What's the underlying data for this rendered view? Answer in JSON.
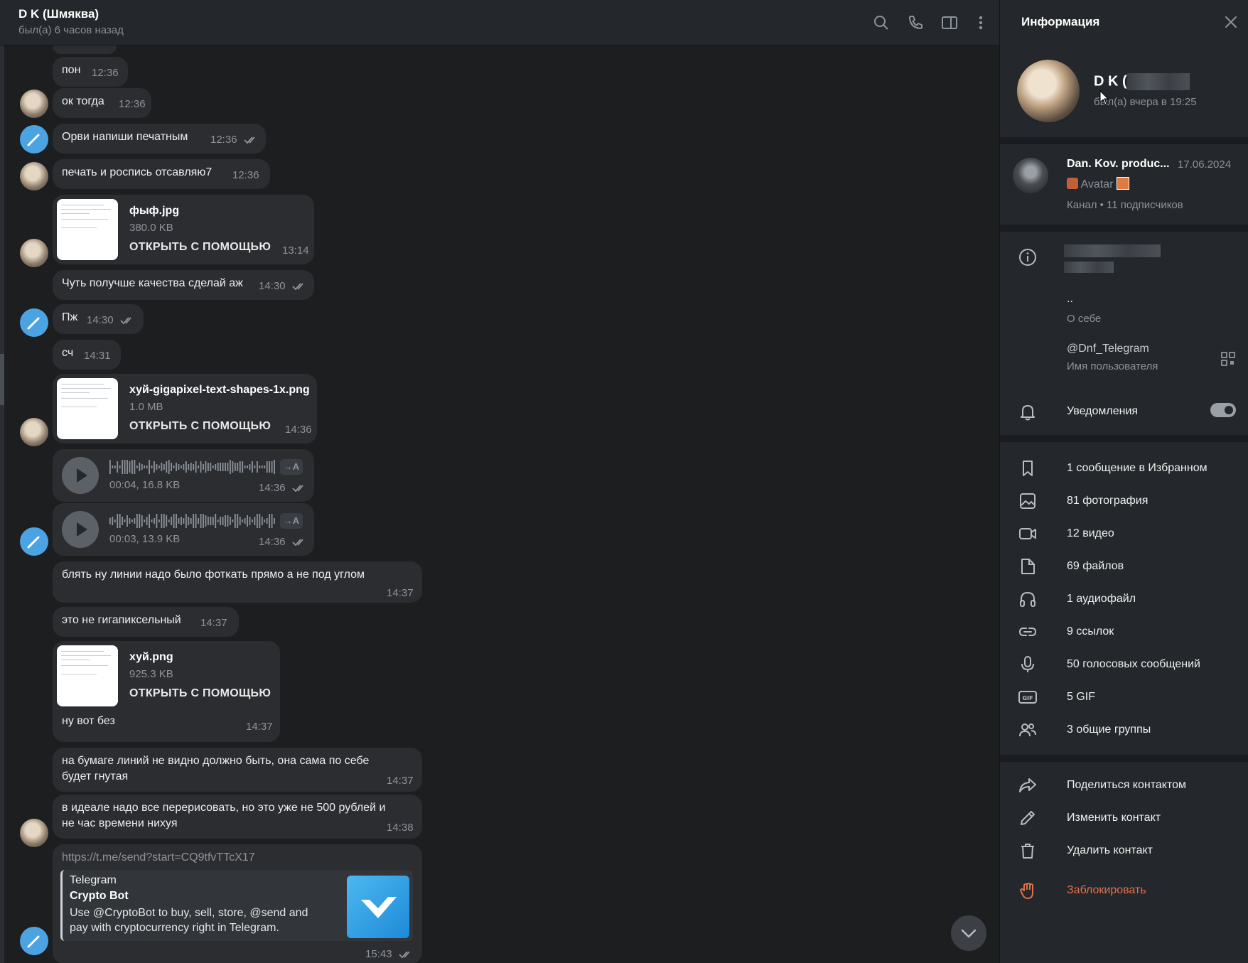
{
  "chat": {
    "title": "D K (Шмяква)",
    "status": "был(а) 6 часов назад"
  },
  "messages": [
    {
      "text": "пон",
      "time": "12:36"
    },
    {
      "text": "ок тогда",
      "time": "12:36"
    },
    {
      "text": "Орви напиши печатным",
      "time": "12:36"
    },
    {
      "text": "печать и роспись отсавляю7",
      "time": "12:36"
    },
    {
      "file": "фыф.jpg",
      "size": "380.0 KB",
      "open": "ОТКРЫТЬ С ПОМОЩЬЮ",
      "time": "13:14"
    },
    {
      "text": "Чуть получше качества сделай аж",
      "time": "14:30"
    },
    {
      "text": "Пж",
      "time": "14:30"
    },
    {
      "text": "сч",
      "time": "14:31"
    },
    {
      "file": "хуй-gigapixel-text-shapes-1x.png",
      "size": "1.0 MB",
      "open": "ОТКРЫТЬ С ПОМОЩЬЮ",
      "time": "14:36"
    },
    {
      "voice": "00:04, 16.8 KB",
      "time": "14:36",
      "transcribe": "→A"
    },
    {
      "voice": "00:03, 13.9 KB",
      "time": "14:36",
      "transcribe": "→A"
    },
    {
      "text": "блять ну линии надо было фоткать прямо а не под углом",
      "time": "14:37"
    },
    {
      "text": "это не гигапиксельный",
      "time": "14:37"
    },
    {
      "file": "хуй.png",
      "size": "925.3 KB",
      "open": "ОТКРЫТЬ С ПОМОЩЬЮ",
      "caption": "ну вот без",
      "time": "14:37"
    },
    {
      "line1": "на бумаге линий не видно должно быть, она сама по себе",
      "line2": "будет гнутая",
      "time": "14:37"
    },
    {
      "line1": "в идеале надо все перерисовать, но это уже не 500 рублей и",
      "line2": "не час времени нихуя",
      "time": "14:38"
    },
    {
      "link": "https://t.me/send?start=CQ9tfvTTcX17",
      "site": "Telegram",
      "title": "Crypto Bot",
      "desc": "Use @CryptoBot to buy, sell, store, @send and pay with cryptocurrency right in Telegram.",
      "time": "15:43"
    }
  ],
  "info": {
    "title": "Информация",
    "profile_name": "D K (",
    "profile_status": "был(а) вчера в 19:25",
    "channel": {
      "name": "Dan. Kov. produc...",
      "date": "17.06.2024",
      "last_message": "Avatar",
      "subtitle": "Канал • 11 подписчиков"
    },
    "bio_value": "..",
    "bio_label": "О себе",
    "username": "@Dnf_Telegram",
    "username_label": "Имя пользователя",
    "notifications": "Уведомления",
    "notifications_on": true,
    "media": [
      {
        "icon": "bookmark-icon",
        "label": "1 сообщение в Избранном"
      },
      {
        "icon": "photo-icon",
        "label": "81 фотография"
      },
      {
        "icon": "video-icon",
        "label": "12 видео"
      },
      {
        "icon": "file-icon",
        "label": "69 файлов"
      },
      {
        "icon": "headphones-icon",
        "label": "1 аудиофайл"
      },
      {
        "icon": "link-icon",
        "label": "9 ссылок"
      },
      {
        "icon": "microphone-icon",
        "label": "50 голосовых сообщений"
      },
      {
        "icon": "gif-icon",
        "label": "5 GIF"
      },
      {
        "icon": "groups-icon",
        "label": "3 общие группы"
      }
    ],
    "actions": [
      {
        "icon": "share-icon",
        "label": "Поделиться контактом"
      },
      {
        "icon": "pencil-icon",
        "label": "Изменить контакт"
      },
      {
        "icon": "trash-icon",
        "label": "Удалить контакт"
      },
      {
        "icon": "block-hand-icon",
        "label": "Заблокировать"
      }
    ]
  },
  "colors": {
    "accent": "#4ba3e2",
    "danger": "#e0714a",
    "bubble": "#2b2d31",
    "panel": "#24272b"
  }
}
